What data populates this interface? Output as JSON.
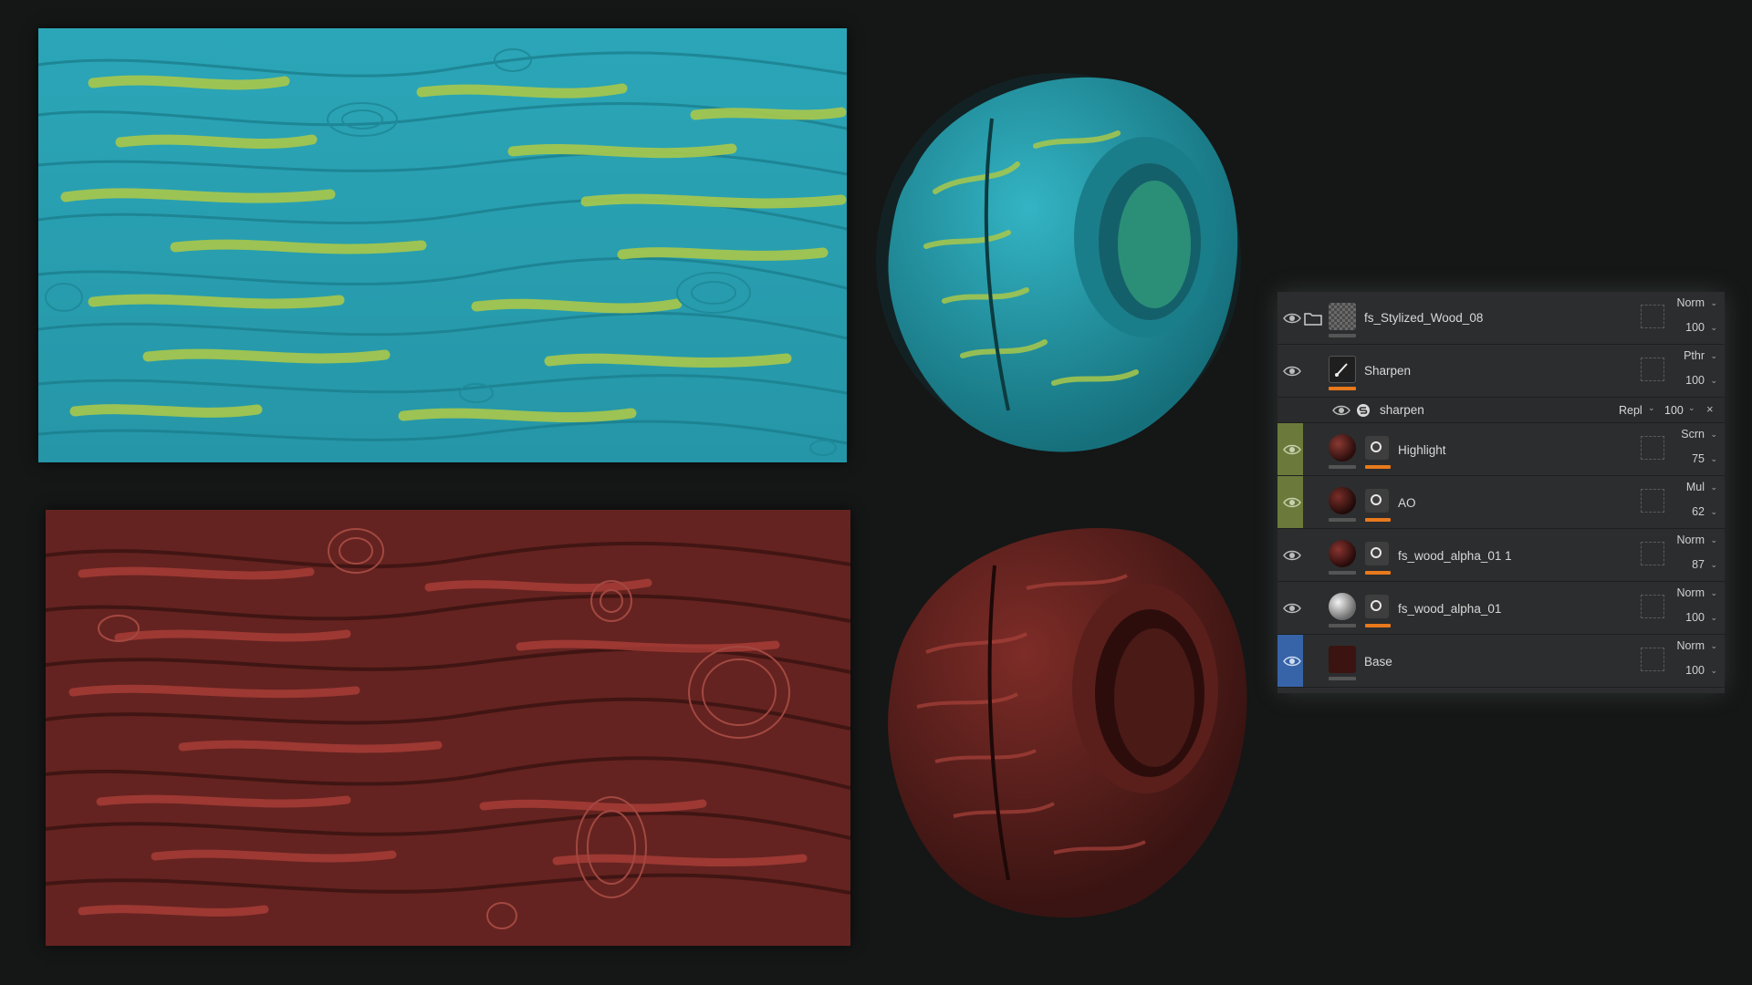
{
  "layers": [
    {
      "name": "fs_Stylized_Wood_08",
      "blend": "Norm",
      "opacity": "100",
      "type": "folder-icon"
    },
    {
      "name": "Sharpen",
      "blend": "Pthr",
      "opacity": "100",
      "type": "brush-icon"
    },
    {
      "name": "sharpen",
      "blend": "Repl",
      "opacity": "100",
      "type": "filter-icon"
    },
    {
      "name": "Highlight",
      "blend": "Scrn",
      "opacity": "75"
    },
    {
      "name": "AO",
      "blend": "Mul",
      "opacity": "62"
    },
    {
      "name": "fs_wood_alpha_01 1",
      "blend": "Norm",
      "opacity": "87"
    },
    {
      "name": "fs_wood_alpha_01",
      "blend": "Norm",
      "opacity": "100"
    },
    {
      "name": "Base",
      "blend": "Norm",
      "opacity": "100"
    }
  ],
  "colors": {
    "accent_orange": "#e8791c",
    "selected_blue": "#3763a8",
    "olive_strip": "#6b7a3a",
    "teal": "#2aa9b9",
    "wood_red": "#6e2621"
  }
}
